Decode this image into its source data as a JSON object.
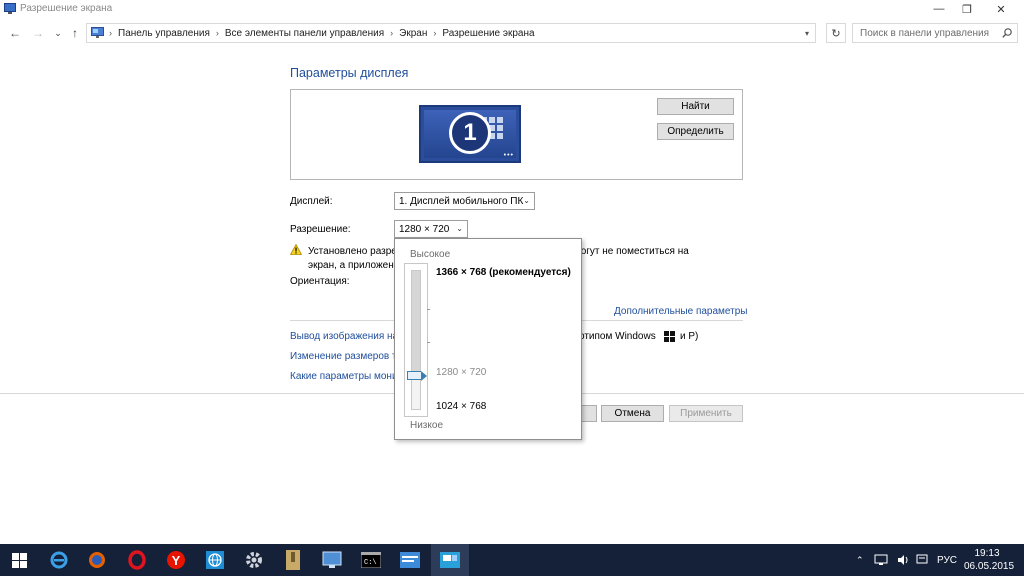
{
  "window": {
    "title": "Разрешение экрана",
    "minimize_glyph": "—",
    "restore_glyph": "❐",
    "close_glyph": "✕"
  },
  "nav": {
    "back_glyph": "←",
    "forward_glyph": "→",
    "recent_glyph": "⌄",
    "up_glyph": "↑",
    "breadcrumbs": [
      "Панель управления",
      "Все элементы панели управления",
      "Экран",
      "Разрешение экрана"
    ],
    "separator": "›",
    "refresh_glyph": "↻",
    "search_placeholder": "Поиск в панели управления"
  },
  "main": {
    "heading": "Параметры дисплея",
    "monitor_number": "1",
    "identify_buttons": {
      "find": "Найти",
      "detect": "Определить"
    },
    "display_label": "Дисплей:",
    "display_value": "1. Дисплей мобильного ПК",
    "resolution_label": "Разрешение:",
    "resolution_value": "1280 × 720",
    "warning_line1_start": "Установлено разре",
    "warning_line1_end": "ы могут не поместиться на",
    "warning_line2": "экран, а приложен",
    "orientation_label": "Ориентация:",
    "advanced_link": "Дополнительные параметры",
    "link_projector_start": "Вывод изображения на",
    "link_projector_end": "отипом Windows",
    "link_projector_tail": "и P)",
    "link_text_size": "Изменение размеров те",
    "link_monitor_settings": "Какие параметры мони",
    "ok_partial": "",
    "cancel_button": "Отмена",
    "apply_button": "Применить"
  },
  "resolution_popup": {
    "high_label": "Высокое",
    "low_label": "Низкое",
    "options": [
      {
        "label": "1366 × 768 (рекомендуется)",
        "bold": true
      },
      {
        "label": "1280 × 720",
        "selected": true
      },
      {
        "label": "1024 × 768"
      }
    ],
    "selected_position_fraction": 0.76
  },
  "taskbar": {
    "apps": [
      "windows-start",
      "internet-explorer",
      "firefox",
      "opera",
      "yandex-browser",
      "globe-app",
      "settings-gear",
      "archive-app",
      "screen-app",
      "command-prompt",
      "file-manager",
      "display-settings"
    ],
    "language": "РУС",
    "time": "19:13",
    "date": "06.05.2015"
  },
  "colors": {
    "link": "#1f4e9c",
    "taskbar": "#142139",
    "monitor": "#2b4d9c",
    "slider_thumb_border": "#3c7fb1"
  }
}
